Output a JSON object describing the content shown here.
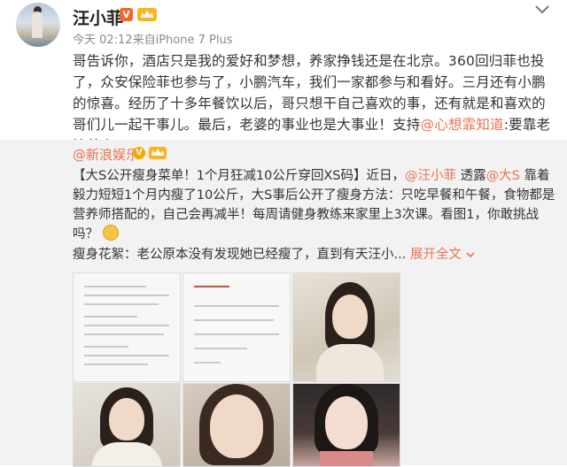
{
  "post": {
    "username": "汪小菲",
    "vip_badge": "V",
    "time": "今天 02:12",
    "source": "来自iPhone 7 Plus",
    "body_part1": "哥告诉你，酒店只是我的爱好和梦想，养家挣钱还是在北京。360回归菲也投了，众安保险菲也参与了，小鹏汽车，我们一家都参与和看好。三月还有小鹏的惊喜。经历了十多年餐饮以后，哥只想干自己喜欢的事，还有就是和喜欢的哥们儿一起干事儿。最后，老婆的事业也是大事业！支持",
    "body_mention": "@心想霏知道",
    "body_part2": ":要靠老婆养家了"
  },
  "repost": {
    "author": "@新浪娱乐",
    "verified": "V",
    "text_a": "【大S公开瘦身菜单！1个月狂减10公斤穿回XS码】近日，",
    "mention1": "@汪小菲",
    "text_b": " 透露",
    "mention2": "@大S",
    "text_c": " 靠着毅力短短1个月内瘦了10公斤，大S事后公开了瘦身方法：只吃早餐和午餐，食物都是营养师搭配的，自己会再减半！每周请健身教练来家里上3次课。看图1，你敢挑战吗？",
    "excerpt": "瘦身花絮：老公原本没有发现她已经瘦了，直到有天汪小...",
    "expand_label": "展开全文",
    "expand_icon": "chevron-down-icon",
    "photo2_text": "终于有人发现我瘦了\n我只做一件事，能让食物减半\n我准备做一件事，\n我已经瘦了十公斤"
  },
  "icons": {
    "menu": "chevron-down-icon",
    "vip": "vip-crown-icon"
  },
  "colors": {
    "accent": "#eb7350",
    "badge": "#f3662a",
    "repost_bg": "#f2f2f2"
  }
}
